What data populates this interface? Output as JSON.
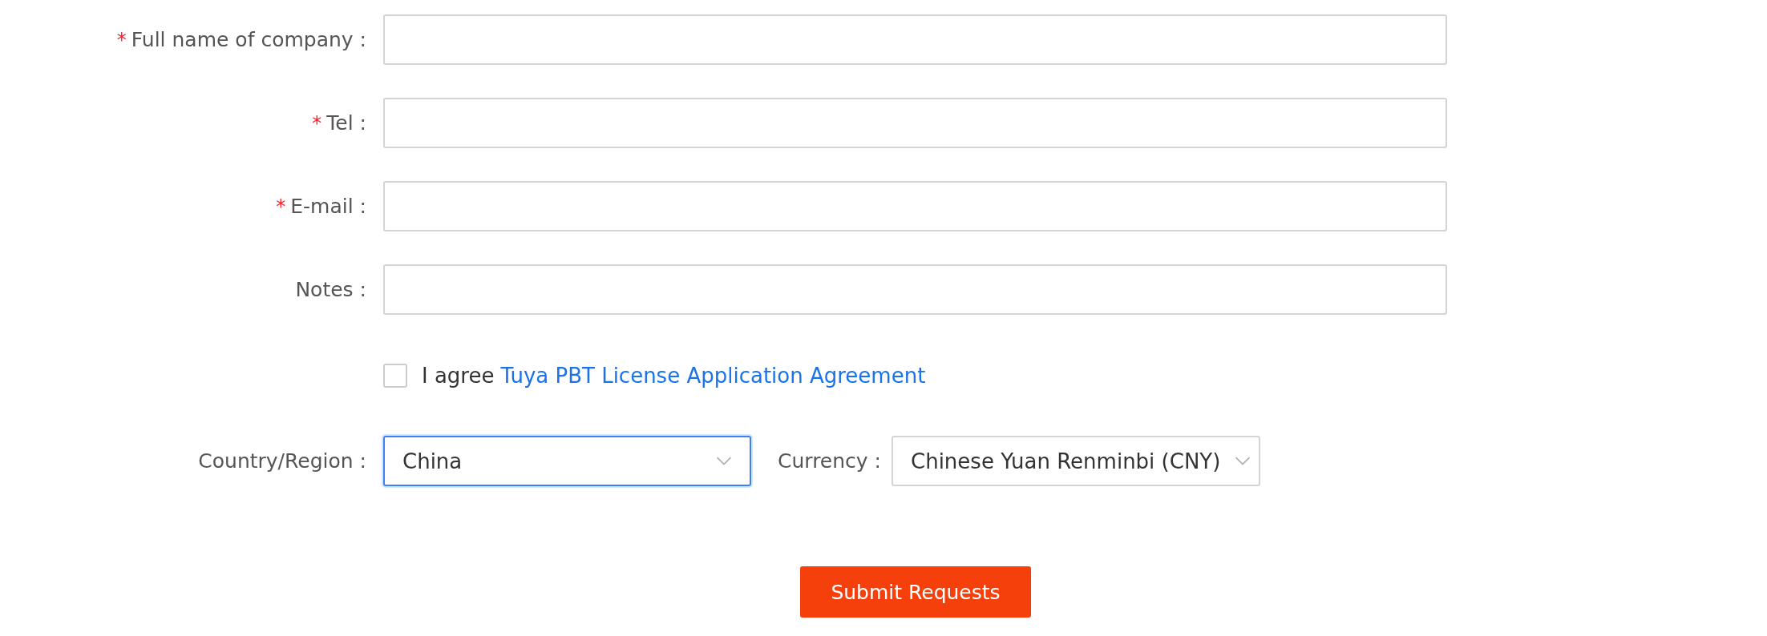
{
  "fields": [
    {
      "label": "Full name of company :",
      "required_mark": "*"
    },
    {
      "label": "Tel :",
      "required_mark": "*"
    },
    {
      "label": "E-mail :",
      "required_mark": "*"
    },
    {
      "label": "Notes :"
    }
  ],
  "agreement": {
    "checked": false,
    "text": "I agree",
    "link": "Tuya PBT License Application Agreement"
  },
  "selects": [
    {
      "label": "Country/Region :",
      "value": "China",
      "focused": true
    },
    {
      "label": "Currency :",
      "value": "Chinese Yuan Renminbi (CNY)",
      "focused": false
    }
  ],
  "submit": "Submit Requests"
}
